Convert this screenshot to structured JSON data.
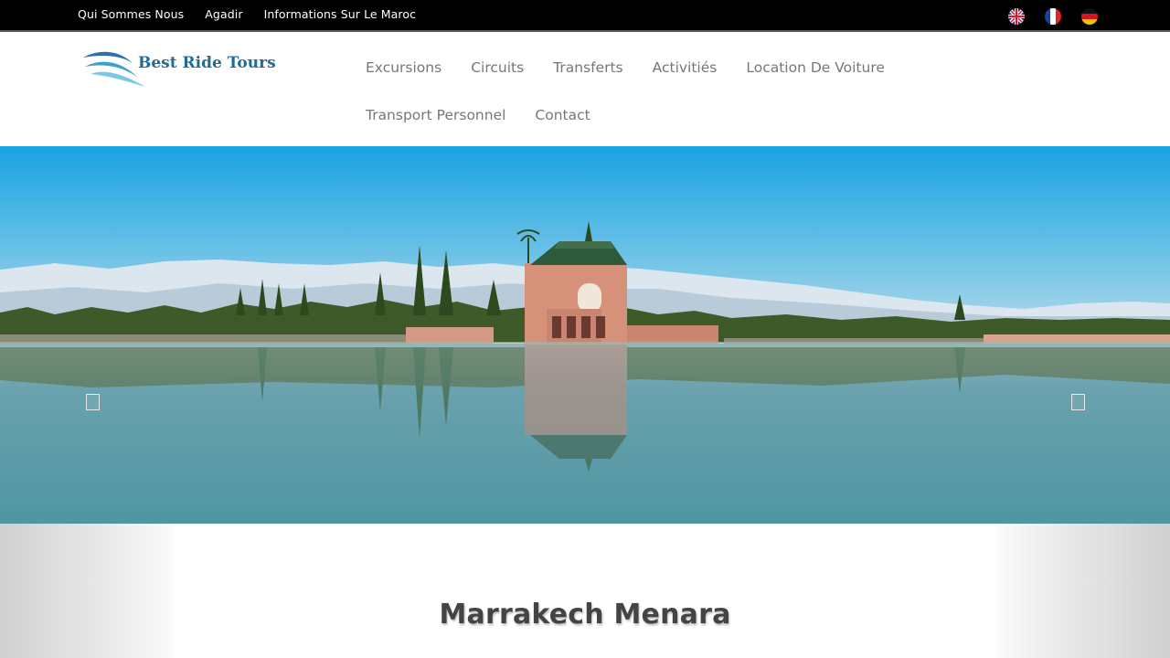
{
  "topbar": {
    "links": [
      "Qui Sommes Nous",
      "Agadir",
      "Informations Sur Le Maroc"
    ],
    "languages": [
      {
        "icon": "uk-flag-icon",
        "name": "English"
      },
      {
        "icon": "france-flag-icon",
        "name": "Français"
      },
      {
        "icon": "germany-flag-icon",
        "name": "Deutsch"
      }
    ]
  },
  "header": {
    "logo_text": "Best Ride Tours",
    "nav": [
      "Excursions",
      "Circuits",
      "Transferts",
      "Activitiés",
      "Location De Voiture",
      "Transport Personnel",
      "Contact"
    ]
  },
  "hero": {
    "prev_icon": "chevron-left-icon",
    "next_icon": "chevron-right-icon"
  },
  "section": {
    "title": "Marrakech Menara"
  },
  "colors": {
    "topbar_bg": "#000000",
    "nav_text": "#777777",
    "logo_blue": "#1f6b96",
    "sky_top": "#1ba3e0",
    "water": "#5e9aa4"
  }
}
